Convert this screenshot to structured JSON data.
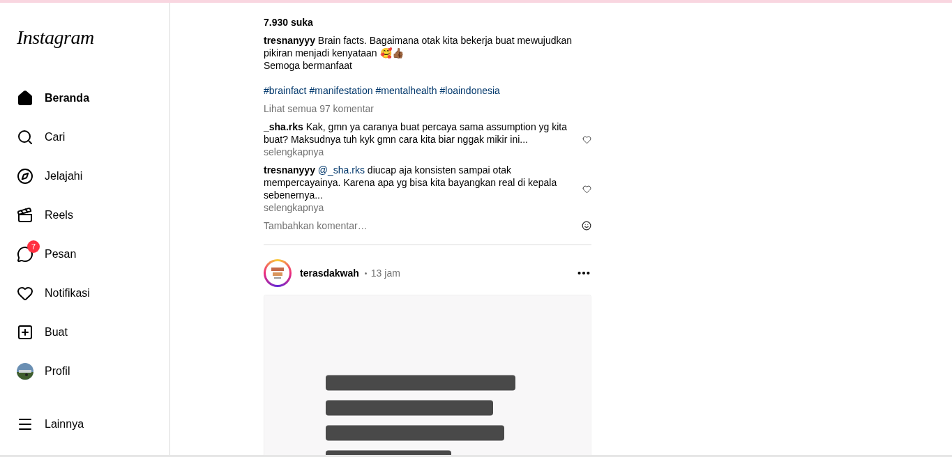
{
  "sidebar": {
    "logo": "Instagram",
    "items": [
      {
        "label": "Beranda",
        "kind": "home",
        "selected": true
      },
      {
        "label": "Cari",
        "kind": "search",
        "selected": false
      },
      {
        "label": "Jelajahi",
        "kind": "compass",
        "selected": false
      },
      {
        "label": "Reels",
        "kind": "reels",
        "selected": false
      },
      {
        "label": "Pesan",
        "kind": "messenger",
        "selected": false,
        "badge": "7"
      },
      {
        "label": "Notifikasi",
        "kind": "heart",
        "selected": false
      },
      {
        "label": "Buat",
        "kind": "create",
        "selected": false
      },
      {
        "label": "Profil",
        "kind": "avatar",
        "selected": false
      }
    ],
    "more": {
      "label": "Lainnya"
    }
  },
  "feed": {
    "post": {
      "likes": "7.930 suka",
      "caption": {
        "author": "tresnanyyy",
        "text": "Brain facts. Bagaimana otak kita bekerja buat mewujudkan pikiran menjadi kenyataan 🥰👍🏾",
        "second_line": "Semoga bermanfaat"
      },
      "hashtags": [
        "#brainfact",
        "#manifestation",
        "#mentalhealth",
        "#loaindonesia"
      ],
      "view_comments": "Lihat semua 97 komentar",
      "comments": [
        {
          "author": "_sha.rks",
          "text": "Kak, gmn ya caranya buat percaya sama assumption yg kita buat? Maksudnya tuh kyk gmn cara kita biar nggak mikir ini...",
          "more": "selengkapnya"
        },
        {
          "author": "tresnanyyy",
          "mention": "@_sha.rks",
          "text": "diucap aja konsisten sampai otak mempercayainya. Karena apa yg bisa kita bayangkan real di kepala sebenernya...",
          "more": "selengkapnya"
        }
      ],
      "add_comment": {
        "placeholder": "Tambahkan komentar…"
      }
    },
    "next_post": {
      "author": "terasdakwah",
      "time": "13 jam"
    }
  }
}
